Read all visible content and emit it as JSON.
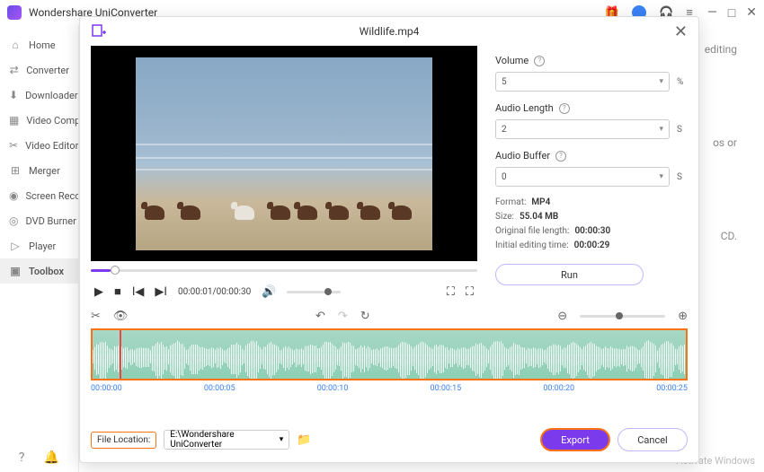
{
  "app": {
    "title": "Wondershare UniConverter"
  },
  "sidebar": {
    "items": [
      {
        "icon": "⌂",
        "label": "Home"
      },
      {
        "icon": "⇄",
        "label": "Converter"
      },
      {
        "icon": "⬇",
        "label": "Downloader"
      },
      {
        "icon": "▦",
        "label": "Video Compressor"
      },
      {
        "icon": "✂",
        "label": "Video Editor"
      },
      {
        "icon": "⊞",
        "label": "Merger"
      },
      {
        "icon": "◉",
        "label": "Screen Recorder"
      },
      {
        "icon": "◎",
        "label": "DVD Burner"
      },
      {
        "icon": "▷",
        "label": "Player"
      },
      {
        "icon": "▣",
        "label": "Toolbox"
      }
    ]
  },
  "bg": {
    "line1": "editing",
    "line2": "os or",
    "line3": "CD."
  },
  "modal": {
    "title": "Wildlife.mp4",
    "props": {
      "volume_label": "Volume",
      "volume_val": "5",
      "volume_unit": "%",
      "length_label": "Audio Length",
      "length_val": "2",
      "length_unit": "S",
      "buffer_label": "Audio Buffer",
      "buffer_val": "0",
      "buffer_unit": "S",
      "format_label": "Format:",
      "format_val": "MP4",
      "size_label": "Size:",
      "size_val": "55.04 MB",
      "orig_label": "Original file length:",
      "orig_val": "00:00:30",
      "init_label": "Initial editing time:",
      "init_val": "00:00:29",
      "run": "Run"
    },
    "player": {
      "time": "00:00:01/00:00:30"
    },
    "ruler": [
      "00:00:00",
      "00:00:05",
      "00:00:10",
      "00:00:15",
      "00:00:20",
      "00:00:25"
    ],
    "footer": {
      "loc_label": "File Location:",
      "loc_val": "E:\\Wondershare UniConverter",
      "export": "Export",
      "cancel": "Cancel"
    }
  },
  "watermark": "Activate Windows"
}
